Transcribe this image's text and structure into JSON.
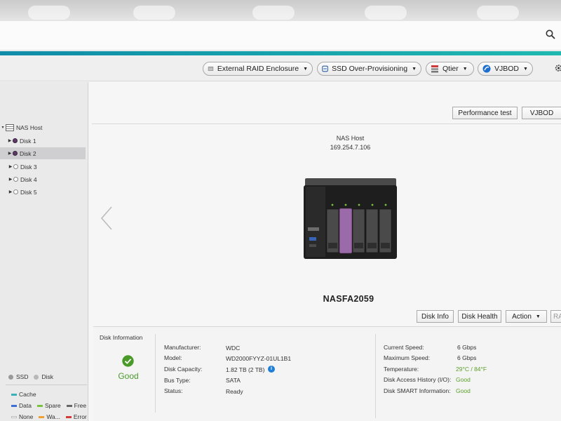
{
  "toolbar": {
    "buttons": [
      {
        "label": "External RAID Enclosure",
        "icon": "enclosure-icon"
      },
      {
        "label": "SSD Over-Provisioning",
        "icon": "ssd-icon"
      },
      {
        "label": "Qtier",
        "icon": "qtier-icon"
      },
      {
        "label": "VJBOD",
        "icon": "vjbod-icon"
      }
    ]
  },
  "tree": {
    "root": "NAS Host",
    "items": [
      "Disk 1",
      "Disk 2",
      "Disk 3",
      "Disk 4",
      "Disk 5"
    ],
    "selected": "Disk 2"
  },
  "legend": {
    "types": [
      "SSD",
      "Disk"
    ],
    "cache": "Cache",
    "row1": [
      "Data",
      "Spare",
      "Free"
    ],
    "row2": [
      "None",
      "Wa...",
      "Error"
    ],
    "colors": {
      "cache": "#3ab0b8",
      "data": "#3f6fd1",
      "spare": "#7cc242",
      "free": "#666666",
      "none": "#ffffff",
      "warning": "#f0a030",
      "error": "#d23a3a"
    }
  },
  "main": {
    "performance_test": "Performance test",
    "vjbod": "VJBOD",
    "nas_title": "NAS Host",
    "nas_ip": "169.254.7.106",
    "device_name": "NASFA2059",
    "actions": {
      "disk_info": "Disk Info",
      "disk_health": "Disk Health",
      "action": "Action",
      "raid_partial": "RA"
    }
  },
  "disk_information": {
    "title": "Disk Information",
    "status_label": "Good",
    "left": [
      {
        "label": "Manufacturer:",
        "value": "WDC"
      },
      {
        "label": "Model:",
        "value": "WD2000FYYZ-01UL1B1"
      },
      {
        "label": "Disk Capacity:",
        "value": "1.82 TB (2 TB)"
      },
      {
        "label": "Bus Type:",
        "value": "SATA"
      },
      {
        "label": "Status:",
        "value": "Ready"
      }
    ],
    "right": [
      {
        "label": "Current Speed:",
        "value": "6 Gbps"
      },
      {
        "label": "Maximum Speed:",
        "value": "6 Gbps"
      },
      {
        "label": "Temperature:",
        "value": "29°C / 84°F"
      },
      {
        "label": "Disk Access History (I/O):",
        "value": "Good"
      },
      {
        "label": "Disk SMART Information:",
        "value": "Good"
      }
    ]
  },
  "colors": {
    "accent": "#1aa8b0",
    "good": "#4a9a2a",
    "selected_disk": "#9b6aa8"
  }
}
